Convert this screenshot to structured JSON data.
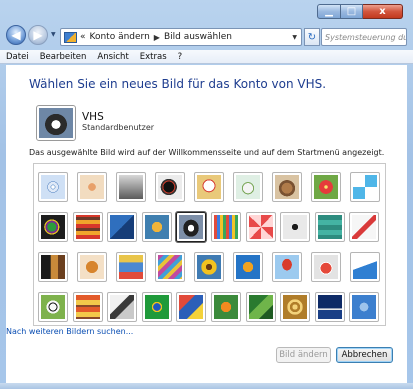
{
  "window": {
    "minimize_glyph": "▁",
    "maximize_glyph": "□",
    "close_glyph": "x"
  },
  "address": {
    "back_glyph": "◀",
    "forward_glyph": "▶",
    "chevrons": "«",
    "crumbs": [
      "Konto ändern",
      "Bild auswählen"
    ],
    "separator": "▶",
    "refresh_glyph": "↻",
    "search_placeholder": "Systemsteuerung durchs..."
  },
  "menu": [
    "Datei",
    "Bearbeiten",
    "Ansicht",
    "Extras",
    "?"
  ],
  "page": {
    "heading": "Wählen Sie ein neues Bild für das Konto von VHS.",
    "user_name": "VHS",
    "user_type": "Standardbenutzer",
    "info": "Das ausgewählte Bild wird auf der Willkommensseite und auf dem Startmenü angezeigt.",
    "more_link": "Nach weiteren Bildern suchen...",
    "change_button": "Bild ändern",
    "cancel_button": "Abbrechen"
  },
  "pictures": [
    [
      "ferris-wheel",
      "starfish",
      "robot",
      "turntable",
      "lucky-cat",
      "satellite-dish",
      "kitten",
      "red-flower",
      "pinwheel"
    ],
    [
      "yarn-ball",
      "stripes",
      "bird-origami",
      "autumn-leaf",
      "border-collie",
      "crayons",
      "star-burst",
      "jacks",
      "stairs",
      "paper-crane"
    ],
    [
      "guitar",
      "puppy",
      "robot-toy",
      "fabric",
      "sunflower",
      "fish",
      "hot-air-balloon",
      "daruma",
      "sailboat"
    ],
    [
      "soccer-ball",
      "shelves",
      "chess",
      "green-frame",
      "kite",
      "butterfly",
      "fern",
      "spiral",
      "lighthouse",
      "shell"
    ]
  ],
  "selected_picture": "border-collie"
}
